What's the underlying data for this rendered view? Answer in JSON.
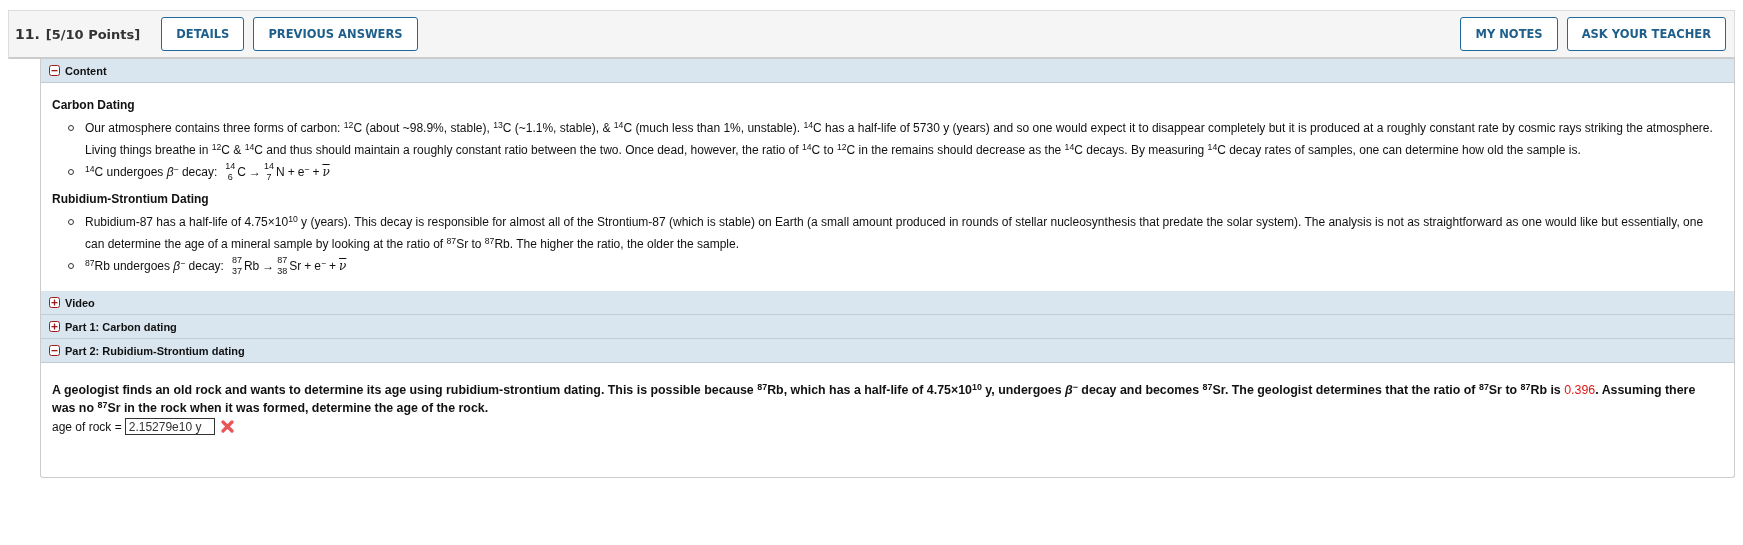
{
  "header": {
    "number": "11.",
    "points": "[5/10 Points]",
    "left_buttons": [
      "DETAILS",
      "PREVIOUS ANSWERS"
    ],
    "right_buttons": [
      "MY NOTES",
      "ASK YOUR TEACHER"
    ]
  },
  "sections": [
    {
      "title": "Content",
      "expanded": true,
      "blocks": [
        {
          "heading": "Carbon Dating",
          "bullets": [
            {
              "text": "Our atmosphere contains three forms of carbon: $^{12}$C (about ~98.9%, stable), $^{13}$C (~1.1%, stable), & $^{14}$C (much less than 1%, unstable). $^{14}$C has a half-life of 5730 y (years) and so one would expect it to disappear completely but it is produced at a roughly constant rate by cosmic rays striking the atmosphere. Living things breathe in $^{12}$C & $^{14}$C and thus should maintain a roughly constant ratio between the two. Once dead, however, the ratio of $^{14}$C to $^{12}$C in the remains should decrease as the $^{14}$C decays. By measuring $^{14}$C decay rates of samples, one can determine how old the sample is."
            },
            {
              "text": "$^{14}$C undergoes *β*$^{−}$ decay:",
              "equation": [
                {
                  "kind": "nuclide",
                  "mass": "14",
                  "atomic": "6",
                  "symbol": "C"
                },
                {
                  "kind": "op",
                  "text": "→"
                },
                {
                  "kind": "nuclide",
                  "mass": "14",
                  "atomic": "7",
                  "symbol": "N"
                },
                {
                  "kind": "op",
                  "text": "+"
                },
                {
                  "kind": "text",
                  "text": "e$^{−}$"
                },
                {
                  "kind": "op",
                  "text": "+"
                },
                {
                  "kind": "bar",
                  "text": "ν"
                }
              ]
            }
          ]
        },
        {
          "heading": "Rubidium-Strontium Dating",
          "bullets": [
            {
              "text": "Rubidium-87 has a half-life of 4.75×10$^{10}$ y (years). This decay is responsible for almost all of the Strontium-87 (which is stable) on Earth (a small amount produced in rounds of stellar nucleosynthesis that predate the solar system). The analysis is not as straightforward as one would like but essentially, one can determine the age of a mineral sample by looking at the ratio of $^{87}$Sr to $^{87}$Rb. The higher the ratio, the older the sample."
            },
            {
              "text": "$^{87}$Rb undergoes *β*$^{−}$ decay:",
              "equation": [
                {
                  "kind": "nuclide",
                  "mass": "87",
                  "atomic": "37",
                  "symbol": "Rb"
                },
                {
                  "kind": "op",
                  "text": "→"
                },
                {
                  "kind": "nuclide",
                  "mass": "87",
                  "atomic": "38",
                  "symbol": "Sr"
                },
                {
                  "kind": "op",
                  "text": "+"
                },
                {
                  "kind": "text",
                  "text": "e$^{−}$"
                },
                {
                  "kind": "op",
                  "text": "+"
                },
                {
                  "kind": "bar",
                  "text": "ν"
                }
              ]
            }
          ]
        }
      ]
    },
    {
      "title": "Video",
      "expanded": false
    },
    {
      "title": "Part 1: Carbon dating",
      "expanded": false
    },
    {
      "title": "Part 2: Rubidium-Strontium dating",
      "expanded": true,
      "question": [
        {
          "kind": "plain",
          "text": "A geologist finds an old rock and wants to determine its age using rubidium-strontium dating. This is possible because $^{87}$Rb, which has a half-life of 4.75×10$^{10}$ y, undergoes *β*$^{−}$ decay and becomes $^{87}$Sr. The geologist determines that the ratio of $^{87}$Sr to $^{87}$Rb is "
        },
        {
          "kind": "value",
          "text": "0.396"
        },
        {
          "kind": "plain",
          "text": ". Assuming there was no $^{87}$Sr in the rock when it was formed, determine the age of the rock."
        }
      ],
      "answer": {
        "label": "age of rock =",
        "value": "2.15279e10 y",
        "correct": false
      }
    }
  ]
}
